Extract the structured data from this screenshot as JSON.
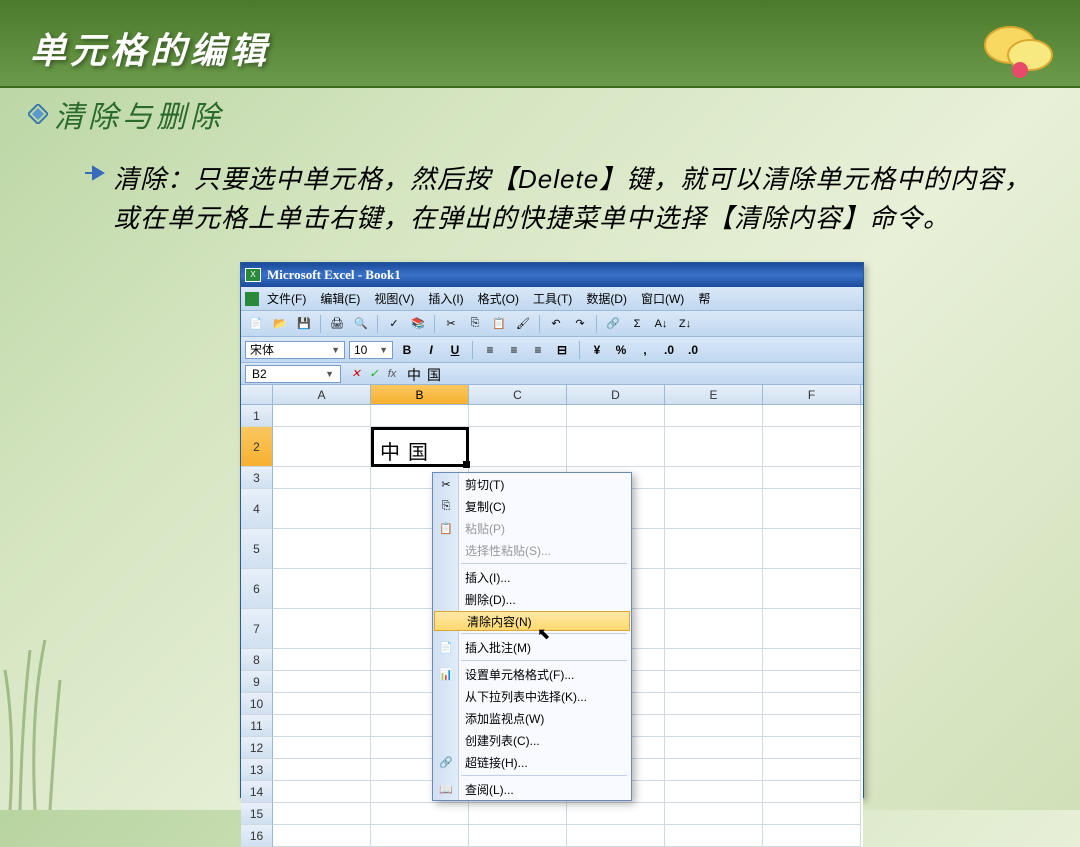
{
  "slide": {
    "title": "单元格的编辑",
    "subtitle": "清除与删除",
    "body": "清除：只要选中单元格，然后按【Delete】键，就可以清除单元格中的内容，或在单元格上单击右键，在弹出的快捷菜单中选择【清除内容】命令。"
  },
  "excel": {
    "title": "Microsoft Excel - Book1",
    "menus": [
      "文件(F)",
      "编辑(E)",
      "视图(V)",
      "插入(I)",
      "格式(O)",
      "工具(T)",
      "数据(D)",
      "窗口(W)",
      "帮"
    ],
    "font": "宋体",
    "size": "10",
    "namebox": "B2",
    "formula": "中国",
    "columns": [
      "A",
      "B",
      "C",
      "D",
      "E",
      "F"
    ],
    "selected_col": "B",
    "rows": [
      "1",
      "2",
      "3",
      "4",
      "5",
      "6",
      "7",
      "8",
      "9",
      "10",
      "11",
      "12",
      "13",
      "14",
      "15",
      "16"
    ],
    "selected_row": "2",
    "selected_cell_value": "中国"
  },
  "menu": {
    "items": [
      {
        "label": "剪切(T)",
        "icon": "✂",
        "enabled": true
      },
      {
        "label": "复制(C)",
        "icon": "⎘",
        "enabled": true
      },
      {
        "label": "粘贴(P)",
        "icon": "📋",
        "enabled": false
      },
      {
        "label": "选择性粘贴(S)...",
        "icon": "",
        "enabled": false
      },
      {
        "sep": true
      },
      {
        "label": "插入(I)...",
        "icon": "",
        "enabled": true
      },
      {
        "label": "删除(D)...",
        "icon": "",
        "enabled": true
      },
      {
        "label": "清除内容(N)",
        "icon": "",
        "enabled": true,
        "hl": true
      },
      {
        "sep": true
      },
      {
        "label": "插入批注(M)",
        "icon": "📄",
        "enabled": true
      },
      {
        "sep": true
      },
      {
        "label": "设置单元格格式(F)...",
        "icon": "📊",
        "enabled": true
      },
      {
        "label": "从下拉列表中选择(K)...",
        "icon": "",
        "enabled": true
      },
      {
        "label": "添加监视点(W)",
        "icon": "",
        "enabled": true
      },
      {
        "label": "创建列表(C)...",
        "icon": "",
        "enabled": true
      },
      {
        "label": "超链接(H)...",
        "icon": "🔗",
        "enabled": true
      },
      {
        "sep": true
      },
      {
        "label": "查阅(L)...",
        "icon": "📖",
        "enabled": true
      }
    ]
  }
}
